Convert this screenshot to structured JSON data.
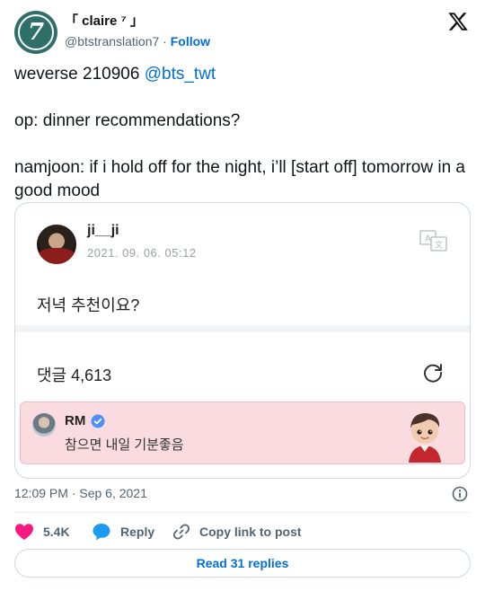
{
  "author": {
    "display_name": "「 claire ⁷ 」",
    "handle": "@btstranslation7",
    "separator": " · ",
    "follow_label": "Follow",
    "avatar_glyph": "7"
  },
  "tweet": {
    "line1_prefix": "weverse 210906 ",
    "line1_mention": "@bts_twt",
    "line2": "op: dinner recommendations?",
    "line3": "namjoon: if i hold off for the night, i’ll [start off] tomorrow in a good mood"
  },
  "embed": {
    "post_user": "ji__ji",
    "post_date": "2021. 09. 06. 05:12",
    "post_body": "저녁 추천이요?",
    "comments_label": "댓글 4,613",
    "comment": {
      "user": "RM",
      "text": "참으면 내일 기분좋음"
    }
  },
  "timestamp": "12:09 PM · Sep 6, 2021",
  "actions": {
    "likes_count": "5.4K",
    "reply_label": "Reply",
    "copy_label": "Copy link to post"
  },
  "read_replies_label": "Read 31 replies",
  "colors": {
    "accent": "#006fd6",
    "heart": "#f91880",
    "reply_bubble": "#1d9bf0",
    "comment_bg": "#fadce0",
    "text_secondary": "#536471"
  },
  "icons": [
    "x-logo-icon",
    "translate-icon",
    "refresh-icon",
    "verified-badge-icon",
    "info-icon",
    "heart-icon",
    "reply-icon",
    "link-icon"
  ]
}
